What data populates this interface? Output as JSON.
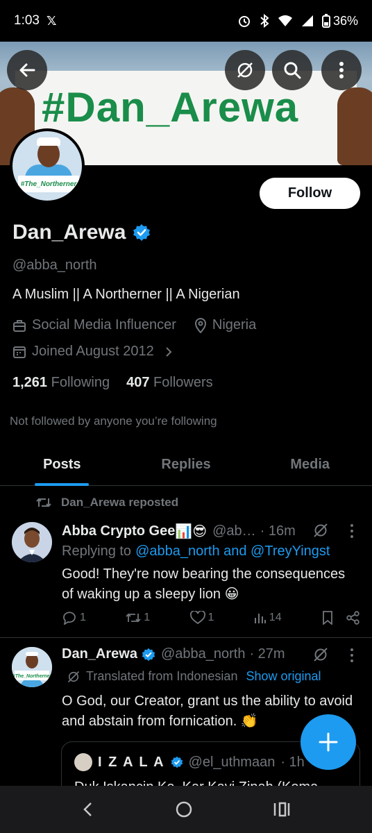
{
  "status_bar": {
    "time": "1:03",
    "app_icon": "x-logo",
    "battery": "36%"
  },
  "banner": {
    "hashtag": "#Dan_Arewa"
  },
  "avatar": {
    "sign_text": "#The_Northerner"
  },
  "profile": {
    "display_name": "Dan_Arewa",
    "handle": "@abba_north",
    "bio": "A Muslim || A Northerner || A Nigerian",
    "category": "Social Media Influencer",
    "location": "Nigeria",
    "joined": "Joined August 2012",
    "following_count": "1,261",
    "following_label": "Following",
    "followers_count": "407",
    "followers_label": "Followers",
    "not_followed": "Not followed by anyone you’re following",
    "follow_label": "Follow"
  },
  "tabs": [
    {
      "label": "Posts"
    },
    {
      "label": "Replies"
    },
    {
      "label": "Media"
    }
  ],
  "tweets": [
    {
      "repost_label": "Dan_Arewa reposted",
      "author": "Abba Crypto Gee",
      "author_emoji": "📊😎",
      "handle": "@ab…",
      "time": "· 16m",
      "reply_prefix": "Replying to",
      "reply_to": "@abba_north and @TreyYingst",
      "text": "Good! They're now bearing the consequences of waking up a sleepy lion 😀",
      "replies": "1",
      "reposts": "1",
      "likes": "1",
      "views": "14"
    },
    {
      "author": "Dan_Arewa",
      "handle": "@abba_north",
      "time": "· 27m",
      "translated_label": "Translated from Indonesian",
      "show_original": "Show original",
      "text": "O God, our Creator, grant us the ability to avoid and abstain from fornication. 👏",
      "quote": {
        "author": "I Z A L A",
        "handle": "@el_uthmaan",
        "time": "· 1h",
        "text": "Duk Iskancin Ke, Kar Kayi Zinah (Koma"
      }
    }
  ],
  "colors": {
    "accent": "#1d9bf0",
    "banner_green": "#1a8d4a",
    "muted": "#71767b"
  }
}
